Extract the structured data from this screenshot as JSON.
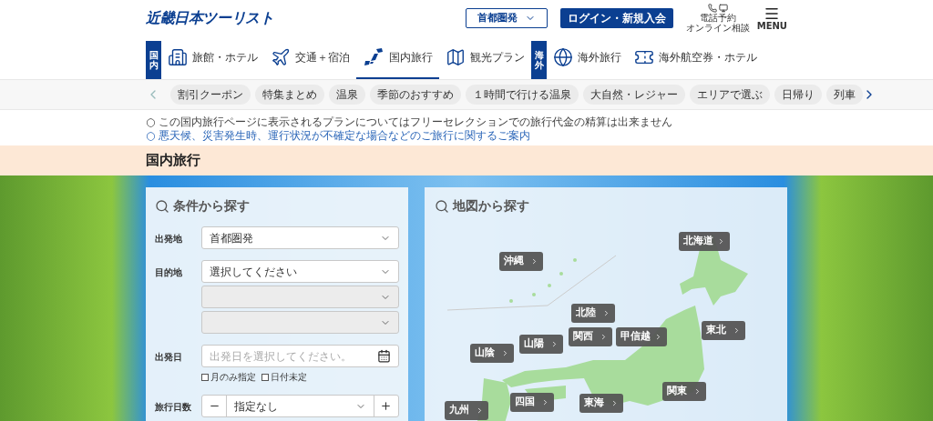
{
  "header": {
    "logo": "近畿日本ツーリスト",
    "region_select": "首都圏発",
    "login": "ログイン・新規入会",
    "phone_labels": [
      "電話予約",
      "オンライン相談"
    ],
    "menu": "MENU"
  },
  "nav": [
    {
      "kind": "section",
      "label": "国内"
    },
    {
      "kind": "link",
      "label": "旅館・ホテル",
      "selected": false
    },
    {
      "kind": "link",
      "label": "交通＋宿泊",
      "selected": false
    },
    {
      "kind": "link",
      "label": "国内旅行",
      "selected": true
    },
    {
      "kind": "link",
      "label": "観光プラン",
      "selected": false
    },
    {
      "kind": "section",
      "label": "海外"
    },
    {
      "kind": "link",
      "label": "海外旅行",
      "selected": false
    },
    {
      "kind": "link",
      "label": "海外航空券・ホテル",
      "selected": false
    }
  ],
  "chips": [
    "割引クーポン",
    "特集まとめ",
    "温泉",
    "季節のおすすめ",
    "１時間で行ける温泉",
    "大自然・レジャー",
    "エリアで選ぶ",
    "日帰り",
    "列車"
  ],
  "notices": [
    {
      "kind": "text",
      "marker": "○",
      "text": "この国内旅行ページに表示されるプランについてはフリーセレクションでの旅行代金の精算は出来ません"
    },
    {
      "kind": "link",
      "marker": "○",
      "text": "悪天候、災害発生時、運行状況が不確定な場合などのご旅行に関するご案内"
    }
  ],
  "section_title": "国内旅行",
  "search": {
    "title": "条件から探す",
    "rows": [
      {
        "label": "出発地",
        "fields": [
          {
            "kind": "select",
            "value": "首都圏発",
            "disabled": false
          }
        ]
      },
      {
        "label": "目的地",
        "fields": [
          {
            "kind": "select",
            "value": "選択してください",
            "disabled": false
          },
          {
            "kind": "select",
            "disabled": true
          },
          {
            "kind": "select",
            "disabled": true
          }
        ]
      },
      {
        "label": "出発日",
        "fields": [
          {
            "kind": "date",
            "placeholder": "出発日を選択してください。"
          }
        ],
        "options": [
          {
            "label": "月のみ指定",
            "checked": false
          },
          {
            "label": "日付未定",
            "checked": false
          }
        ]
      },
      {
        "label": "旅行日数",
        "fields": [
          {
            "kind": "stepper",
            "value": "指定なし"
          }
        ]
      }
    ]
  },
  "map": {
    "title": "地図から探す",
    "regions": [
      "北海道",
      "沖縄",
      "北陸",
      "山陰",
      "山陽",
      "関西",
      "甲信越",
      "東北",
      "九州",
      "四国",
      "東海",
      "関東"
    ]
  }
}
